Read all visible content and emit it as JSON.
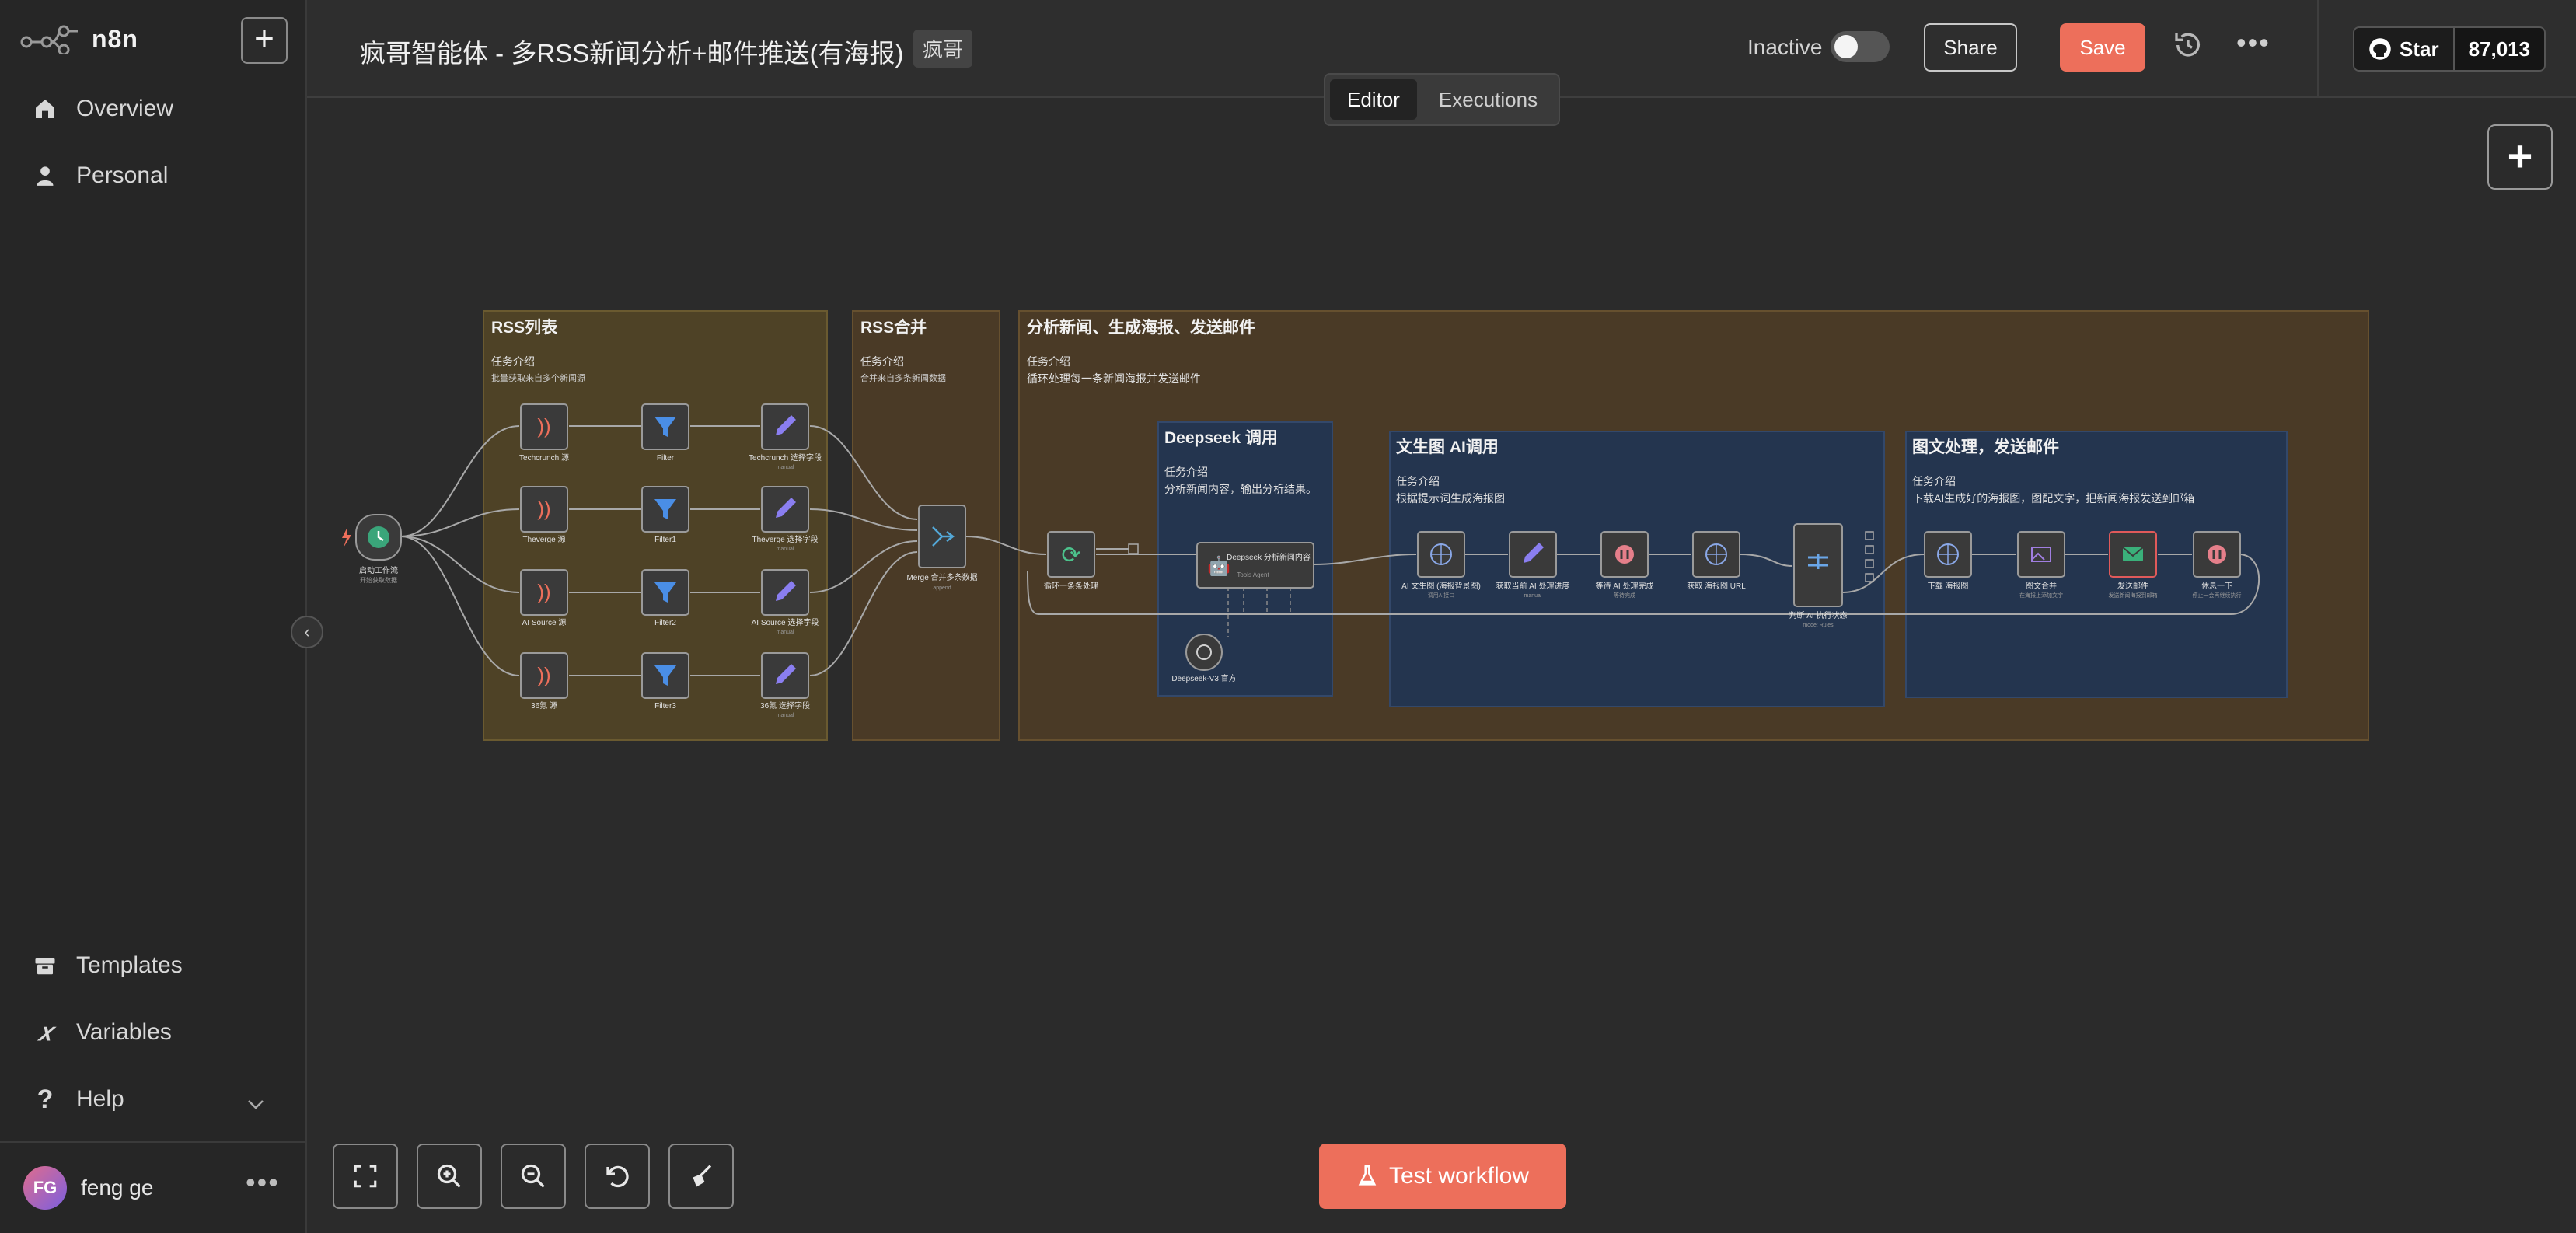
{
  "app": {
    "name": "n8n"
  },
  "sidebar": {
    "items": [
      {
        "label": "Overview",
        "icon": "home-icon"
      },
      {
        "label": "Personal",
        "icon": "user-icon"
      },
      {
        "label": "Templates",
        "icon": "box-icon"
      },
      {
        "label": "Variables",
        "icon": "variable-icon"
      },
      {
        "label": "Help",
        "icon": "question-icon"
      }
    ],
    "user": {
      "initials": "FG",
      "name": "feng ge"
    }
  },
  "header": {
    "title": "疯哥智能体 - 多RSS新闻分析+邮件推送(有海报)",
    "tag": "疯哥",
    "active_label": "Inactive",
    "share_label": "Share",
    "save_label": "Save",
    "github_star_label": "Star",
    "github_star_count": "87,013"
  },
  "tabs": [
    {
      "label": "Editor",
      "active": true
    },
    {
      "label": "Executions",
      "active": false
    }
  ],
  "toolbar": {
    "test_label": "Test workflow"
  },
  "colors": {
    "accent": "#ed6f5b",
    "sticky_yellow": "#4e4226",
    "sticky_brown": "#4a3a26",
    "sticky_blue": "#24354f"
  },
  "workflow": {
    "groups": [
      {
        "title": "RSS列表",
        "intro": "任务介绍",
        "desc": "批量获取来自多个新闻源",
        "color": "yellow"
      },
      {
        "title": "RSS合并",
        "intro": "任务介绍",
        "desc": "合并来自多条新闻数据",
        "color": "brown"
      },
      {
        "title": "分析新闻、生成海报、发送邮件",
        "intro": "任务介绍",
        "desc": "循环处理每一条新闻海报并发送邮件",
        "color": "brown"
      },
      {
        "title": "Deepseek 调用",
        "intro": "任务介绍",
        "desc": "分析新闻内容，输出分析结果。",
        "color": "blue"
      },
      {
        "title": "文生图 AI调用",
        "intro": "任务介绍",
        "desc": "根据提示词生成海报图",
        "color": "blue"
      },
      {
        "title": "图文处理，发送邮件",
        "intro": "任务介绍",
        "desc": "下载AI生成好的海报图，图配文字，把新闻海报发送到邮箱",
        "color": "blue"
      }
    ],
    "nodes": [
      {
        "label": "启动工作流",
        "sub": "开始获取数据",
        "icon": "clock-icon"
      },
      {
        "label": "Techcrunch 源",
        "sub": "",
        "icon": "rss-icon"
      },
      {
        "label": "Theverge 源",
        "sub": "",
        "icon": "rss-icon"
      },
      {
        "label": "AI Source 源",
        "sub": "",
        "icon": "rss-icon"
      },
      {
        "label": "36氪 源",
        "sub": "",
        "icon": "rss-icon"
      },
      {
        "label": "Filter",
        "sub": "",
        "icon": "filter-icon"
      },
      {
        "label": "Filter1",
        "sub": "",
        "icon": "filter-icon"
      },
      {
        "label": "Filter2",
        "sub": "",
        "icon": "filter-icon"
      },
      {
        "label": "Filter3",
        "sub": "",
        "icon": "filter-icon"
      },
      {
        "label": "Techcrunch 选择字段",
        "sub": "manual",
        "icon": "pencil-icon"
      },
      {
        "label": "Theverge 选择字段",
        "sub": "manual",
        "icon": "pencil-icon"
      },
      {
        "label": "AI Source 选择字段",
        "sub": "manual",
        "icon": "pencil-icon"
      },
      {
        "label": "36氪 选择字段",
        "sub": "manual",
        "icon": "pencil-icon"
      },
      {
        "label": "Merge 合并多条数据",
        "sub": "append",
        "icon": "merge-icon"
      },
      {
        "label": "循环一条条处理",
        "sub": "",
        "icon": "loop-icon"
      },
      {
        "label": "Deepseek 分析新闻内容",
        "sub": "Tools Agent",
        "icon": "robot-icon"
      },
      {
        "label": "Deepseek-V3 官方",
        "sub": "",
        "icon": "openai-icon"
      },
      {
        "label": "AI 文生图 (海报背景图)",
        "sub": "调用AI接口",
        "icon": "globe-icon"
      },
      {
        "label": "获取当前 AI 处理进度",
        "sub": "manual",
        "icon": "pencil-icon"
      },
      {
        "label": "等待 AI 处理完成",
        "sub": "等待完成",
        "icon": "pause-icon"
      },
      {
        "label": "获取 海报图 URL",
        "sub": "",
        "icon": "globe-icon"
      },
      {
        "label": "判断 AI 执行状态",
        "sub": "mode: Rules",
        "icon": "switch-icon"
      },
      {
        "label": "下载 海报图",
        "sub": "",
        "icon": "globe-icon"
      },
      {
        "label": "图文合并",
        "sub": "在海报上添加文字",
        "icon": "image-icon"
      },
      {
        "label": "发送邮件",
        "sub": "发送新闻海报到邮箱",
        "icon": "mail-icon"
      },
      {
        "label": "休息一下",
        "sub": "停止一会再继续执行",
        "icon": "pause-icon"
      }
    ]
  }
}
